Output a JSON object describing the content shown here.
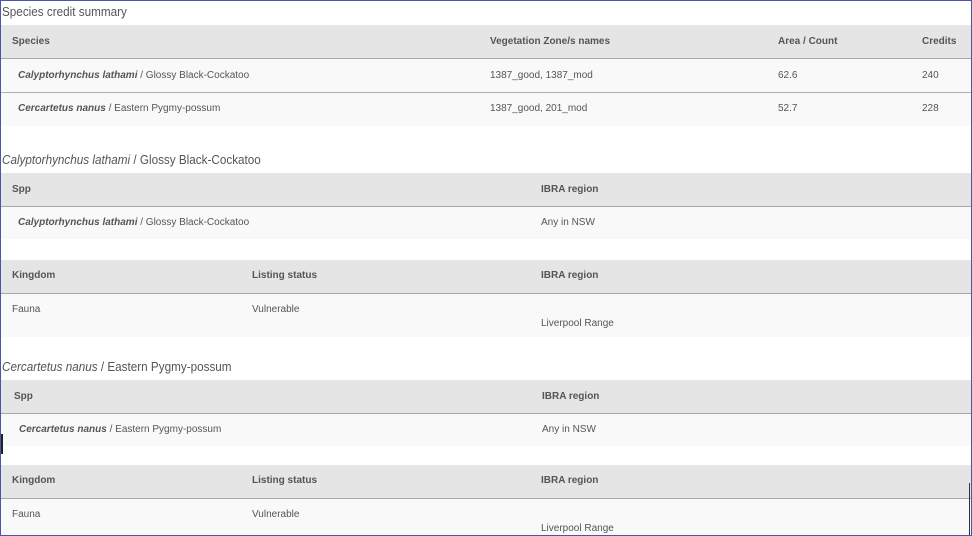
{
  "summary": {
    "title": "Species credit summary",
    "headers": [
      "Species",
      "Vegetation Zone/s names",
      "Area / Count",
      "Credits"
    ],
    "rows": [
      {
        "sci": "Calyptorhynchus lathami",
        "common": " / Glossy Black-Cockatoo",
        "zones": "1387_good, 1387_mod",
        "area": "62.6",
        "credits": "240"
      },
      {
        "sci": "Cercartetus nanus",
        "common": " / Eastern Pygmy-possum",
        "zones": "1387_good, 201_mod",
        "area": "52.7",
        "credits": "228"
      }
    ]
  },
  "species": [
    {
      "title_sci": "Calyptorhynchus lathami",
      "title_common": " / Glossy Black-Cockatoo",
      "spp_header": "Spp",
      "ibra_header": "IBRA region",
      "spp_sci": "Calyptorhynchus lathami",
      "spp_common": " / Glossy Black-Cockatoo",
      "ibra": "Any in NSW",
      "kingdom_header": "Kingdom",
      "listing_header": "Listing status",
      "ibra_header2": "IBRA region",
      "kingdom": "Fauna",
      "listing": "Vulnerable",
      "region": "Liverpool Range"
    },
    {
      "title_sci": "Cercartetus nanus",
      "title_common": " / Eastern Pygmy-possum",
      "spp_header": "Spp",
      "ibra_header": "IBRA region",
      "spp_sci": "Cercartetus nanus",
      "spp_common": " / Eastern Pygmy-possum",
      "ibra": "Any in NSW",
      "kingdom_header": "Kingdom",
      "listing_header": "Listing status",
      "ibra_header2": "IBRA region",
      "kingdom": "Fauna",
      "listing": "Vulnerable",
      "region": "Liverpool Range"
    }
  ]
}
